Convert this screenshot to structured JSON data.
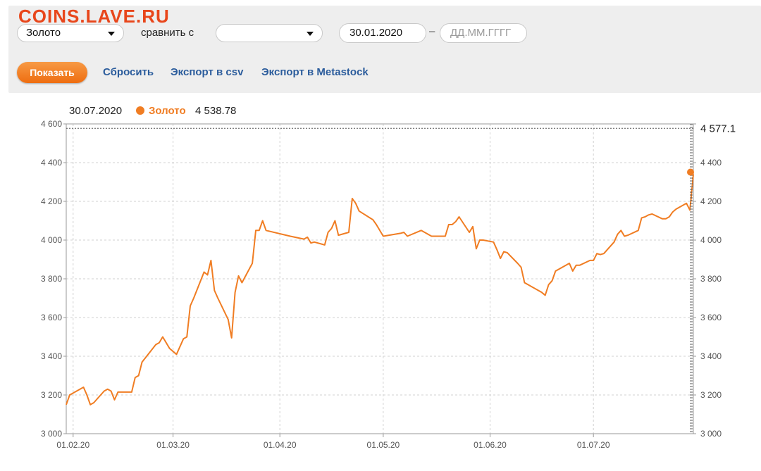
{
  "watermark": "COINS.LAVE.RU",
  "toolbar": {
    "instrument_select": "Золото",
    "compare_label": "сравнить с",
    "compare_select": "",
    "date_from": "30.01.2020",
    "date_separator": "–",
    "date_to_placeholder": "ДД.ММ.ГГГГ",
    "show_button": "Показать",
    "reset_link": "Сбросить",
    "export_csv_link": "Экспорт в csv",
    "export_metastock_link": "Экспорт в Metastock"
  },
  "legend": {
    "date": "30.07.2020",
    "series_name": "Золото",
    "value": "4 538.78"
  },
  "colors": {
    "series": "#f07d23",
    "link": "#2b5c9c",
    "watermark": "#e8461b"
  },
  "chart_data": {
    "type": "line",
    "title": "",
    "xlabel": "",
    "ylabel": "",
    "ylim": [
      3000,
      4600
    ],
    "y_ticks": [
      3000,
      3200,
      3400,
      3600,
      3800,
      4000,
      4200,
      4400,
      4600
    ],
    "y_tick_labels": [
      "3 000",
      "3 200",
      "3 400",
      "3 600",
      "3 800",
      "4 000",
      "4 200",
      "4 400",
      "4 600"
    ],
    "x_range": [
      "2020-01-30",
      "2020-07-30"
    ],
    "x_ticks": [
      "2020-02-01",
      "2020-03-01",
      "2020-04-01",
      "2020-05-01",
      "2020-06-01",
      "2020-07-01"
    ],
    "x_tick_labels": [
      "01.02.20",
      "01.03.20",
      "01.04.20",
      "01.05.20",
      "01.06.20",
      "01.07.20"
    ],
    "grid": true,
    "last_value_label": "4 577.1",
    "series": [
      {
        "name": "Золото",
        "color": "#f07d23",
        "x": [
          "2020-01-30",
          "2020-01-31",
          "2020-02-04",
          "2020-02-05",
          "2020-02-06",
          "2020-02-07",
          "2020-02-10",
          "2020-02-11",
          "2020-02-12",
          "2020-02-13",
          "2020-02-14",
          "2020-02-15",
          "2020-02-18",
          "2020-02-19",
          "2020-02-20",
          "2020-02-21",
          "2020-02-25",
          "2020-02-26",
          "2020-02-27",
          "2020-02-28",
          "2020-02-29",
          "2020-03-02",
          "2020-03-04",
          "2020-03-05",
          "2020-03-06",
          "2020-03-07",
          "2020-03-10",
          "2020-03-11",
          "2020-03-12",
          "2020-03-13",
          "2020-03-14",
          "2020-03-17",
          "2020-03-18",
          "2020-03-19",
          "2020-03-20",
          "2020-03-21",
          "2020-03-24",
          "2020-03-25",
          "2020-03-26",
          "2020-03-27",
          "2020-03-28",
          "2020-04-04",
          "2020-04-08",
          "2020-04-09",
          "2020-04-10",
          "2020-04-11",
          "2020-04-14",
          "2020-04-15",
          "2020-04-16",
          "2020-04-17",
          "2020-04-18",
          "2020-04-21",
          "2020-04-22",
          "2020-04-23",
          "2020-04-24",
          "2020-04-28",
          "2020-04-29",
          "2020-04-30",
          "2020-05-01",
          "2020-05-06",
          "2020-05-07",
          "2020-05-08",
          "2020-05-12",
          "2020-05-13",
          "2020-05-14",
          "2020-05-15",
          "2020-05-19",
          "2020-05-20",
          "2020-05-21",
          "2020-05-22",
          "2020-05-23",
          "2020-05-26",
          "2020-05-27",
          "2020-05-28",
          "2020-05-29",
          "2020-05-30",
          "2020-06-02",
          "2020-06-03",
          "2020-06-04",
          "2020-06-05",
          "2020-06-06",
          "2020-06-09",
          "2020-06-10",
          "2020-06-11",
          "2020-06-16",
          "2020-06-17",
          "2020-06-18",
          "2020-06-19",
          "2020-06-20",
          "2020-06-23",
          "2020-06-24",
          "2020-06-25",
          "2020-06-26",
          "2020-06-27",
          "2020-06-30",
          "2020-07-01",
          "2020-07-02",
          "2020-07-03",
          "2020-07-04",
          "2020-07-07",
          "2020-07-08",
          "2020-07-09",
          "2020-07-10",
          "2020-07-11",
          "2020-07-14",
          "2020-07-15",
          "2020-07-16",
          "2020-07-17",
          "2020-07-18",
          "2020-07-21",
          "2020-07-22",
          "2020-07-23",
          "2020-07-24",
          "2020-07-25",
          "2020-07-28",
          "2020-07-29",
          "2020-07-30"
        ],
        "y": [
          3150,
          3200,
          3240,
          3200,
          3150,
          3160,
          3220,
          3230,
          3220,
          3175,
          3215,
          3215,
          3215,
          3290,
          3300,
          3370,
          3460,
          3470,
          3500,
          3470,
          3440,
          3410,
          3490,
          3500,
          3660,
          3700,
          3835,
          3820,
          3895,
          3740,
          3700,
          3590,
          3495,
          3730,
          3815,
          3780,
          3880,
          4050,
          4050,
          4100,
          4050,
          4020,
          4005,
          4015,
          3985,
          3990,
          3975,
          4040,
          4060,
          4100,
          4025,
          4040,
          4215,
          4190,
          4150,
          4105,
          4080,
          4050,
          4020,
          4035,
          4040,
          4020,
          4050,
          4040,
          4030,
          4020,
          4020,
          4080,
          4080,
          4095,
          4120,
          4040,
          4070,
          3955,
          4000,
          4000,
          3990,
          3950,
          3905,
          3940,
          3935,
          3880,
          3860,
          3780,
          3730,
          3715,
          3770,
          3790,
          3840,
          3870,
          3880,
          3840,
          3870,
          3870,
          3895,
          3895,
          3930,
          3925,
          3930,
          3990,
          4030,
          4050,
          4020,
          4025,
          4050,
          4115,
          4120,
          4130,
          4135,
          4110,
          4110,
          4120,
          4145,
          4160,
          4190,
          4155,
          4340
        ]
      }
    ]
  }
}
